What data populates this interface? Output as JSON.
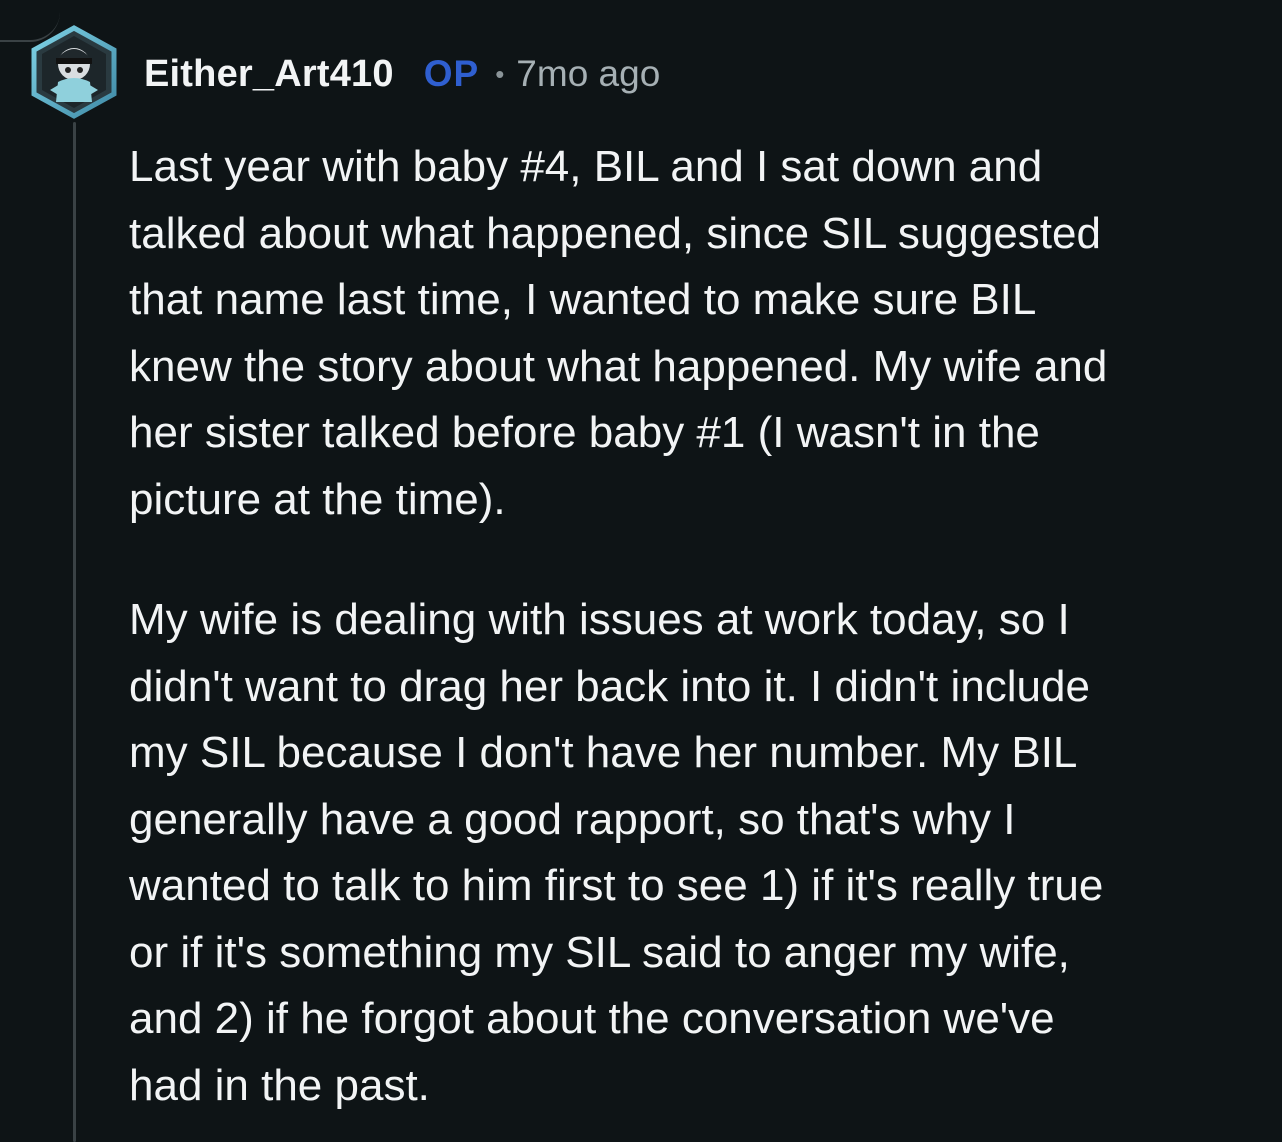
{
  "comment": {
    "author": "Either_Art410",
    "op_badge": "OP",
    "separator": "•",
    "timestamp": "7mo ago",
    "paragraphs": [
      [
        "Last year with baby #4, BIL and I sat down and",
        "talked about what happened, since SIL suggested",
        "that name last time, I wanted to make sure BIL",
        "knew the story about what happened. My wife and",
        "her sister talked before baby #1 (I wasn't in the",
        "picture at the time)."
      ],
      [
        "My wife is dealing with issues at work today, so I",
        "didn't want to drag her back into it. I didn't include",
        "my SIL because I don't have her number. My BIL",
        "generally have a good rapport, so that's why I",
        "wanted to talk to him first to see 1) if it's really true",
        "or if it's something my SIL said to anger my wife,",
        "and 2) if he forgot about the conversation we've",
        "had in the past."
      ]
    ]
  },
  "colors": {
    "background": "#0e1416",
    "text": "#f2f4f5",
    "op_badge": "#2f5fd0",
    "muted": "#a6b0b4",
    "thread_line": "#3a4245"
  },
  "icons": {
    "avatar": "snoo-avatar-icon"
  }
}
